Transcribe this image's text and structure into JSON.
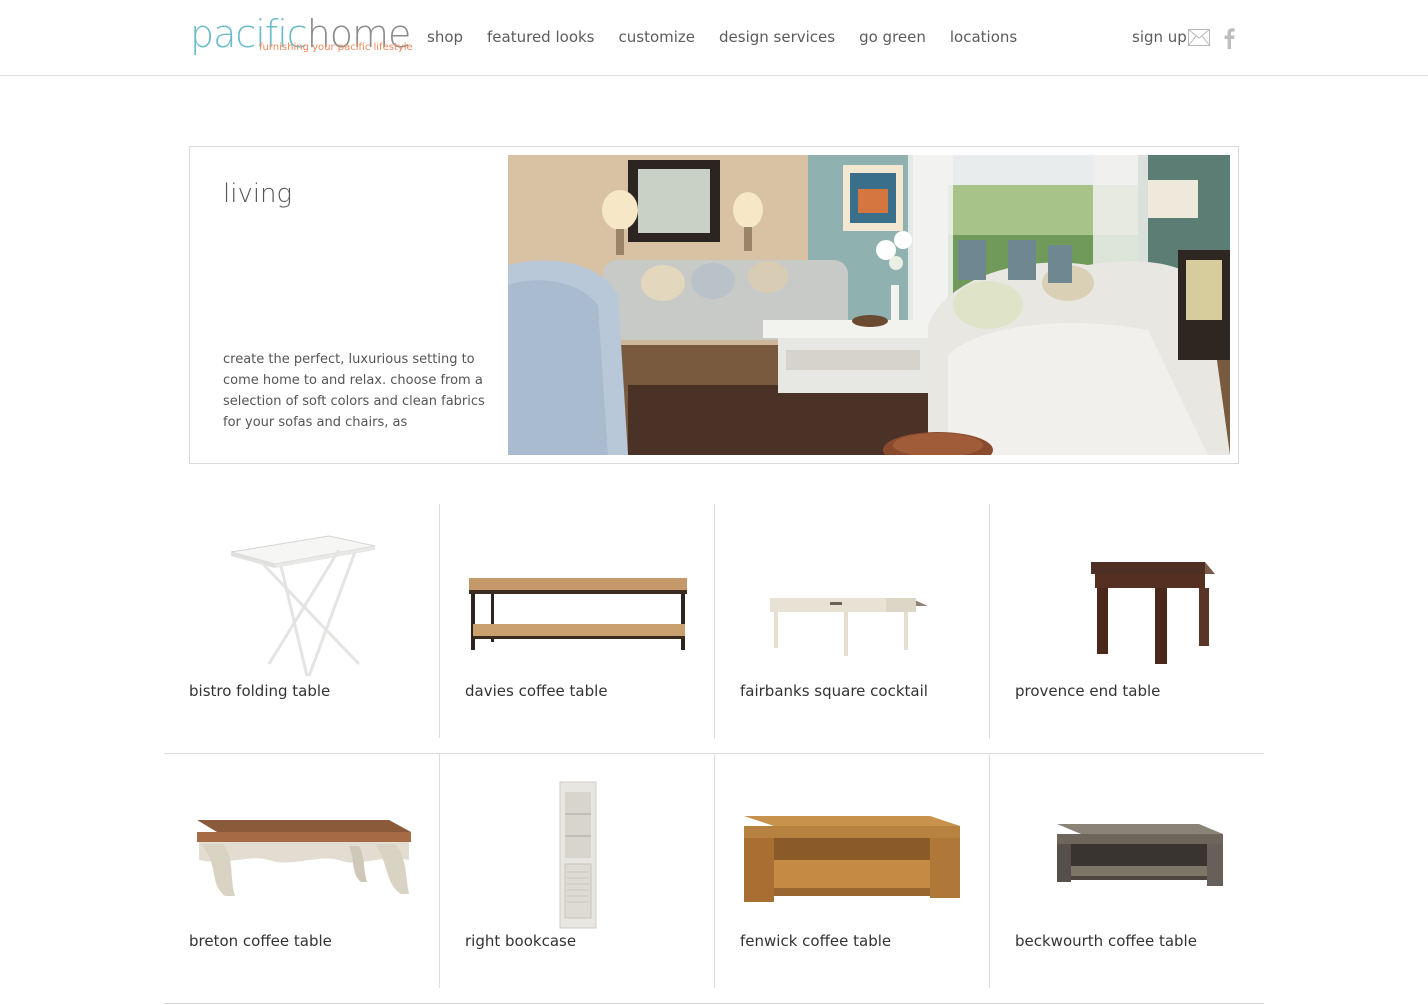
{
  "brand": {
    "name_part1": "pacific",
    "name_part2": "home",
    "tagline": "furnishing your pacific lifestyle",
    "color_primary": "#6bbcc8",
    "color_secondary": "#8c8c8c",
    "color_accent": "#ef8a5b"
  },
  "nav": {
    "items": [
      {
        "label": "shop"
      },
      {
        "label": "featured looks"
      },
      {
        "label": "customize"
      },
      {
        "label": "design services"
      },
      {
        "label": "go green"
      },
      {
        "label": "locations"
      }
    ],
    "signup_label": "sign up",
    "mail_icon": "mail-icon",
    "facebook_icon": "facebook-icon"
  },
  "hero": {
    "title": "living",
    "description": "create the perfect, luxurious setting to come home to and relax. choose from a selection of soft colors and clean fabrics for your sofas and chairs, as"
  },
  "products": {
    "row1": [
      {
        "name": "bistro folding table"
      },
      {
        "name": "davies coffee table"
      },
      {
        "name": "fairbanks square cocktail"
      },
      {
        "name": "provence end table"
      }
    ],
    "row2": [
      {
        "name": "breton coffee table"
      },
      {
        "name": "right bookcase"
      },
      {
        "name": "fenwick coffee table"
      },
      {
        "name": "beckwourth coffee table"
      }
    ]
  }
}
